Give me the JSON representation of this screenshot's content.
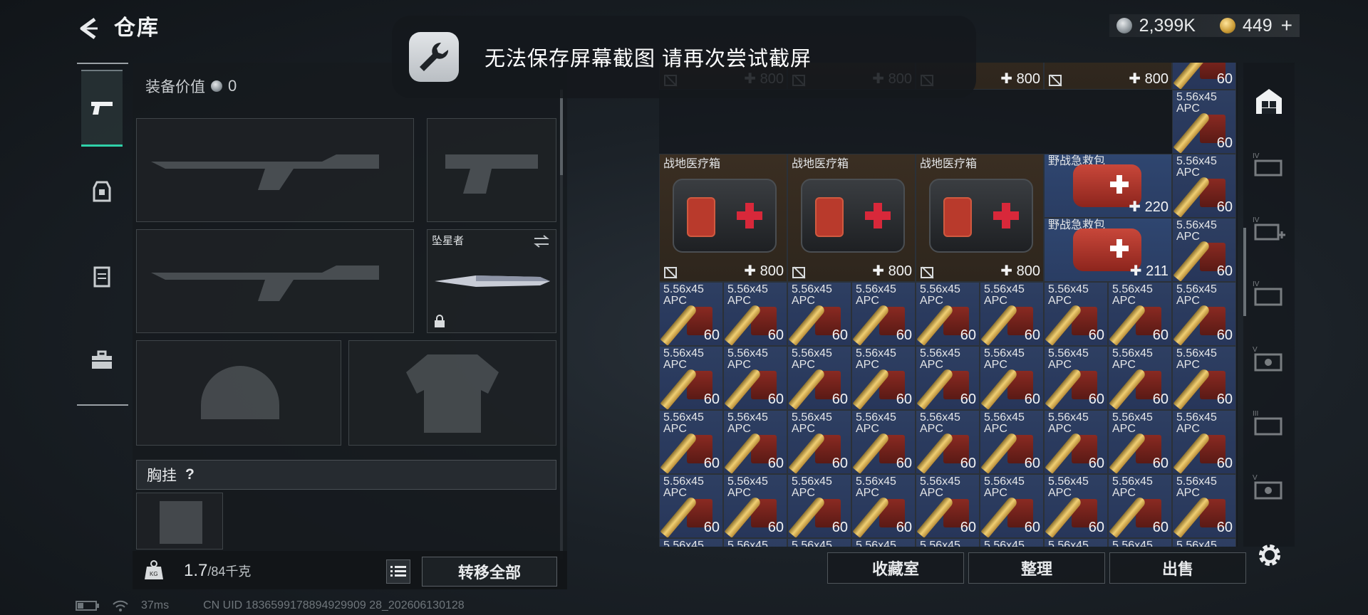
{
  "header": {
    "back_label": "<",
    "title": "仓库"
  },
  "currency": {
    "silver": "2,399K",
    "gold": "449",
    "add_label": "+"
  },
  "toast": {
    "message": "无法保存屏幕截图  请再次尝试截屏"
  },
  "equip": {
    "value_label": "装备价值",
    "value": "0",
    "melee_name": "坠星者",
    "chest_rig_label": "胸挂",
    "chest_rig_help": "?",
    "weight": "1.7",
    "weight_max": "/84千克",
    "transfer_all": "转移全部"
  },
  "storage": {
    "items": {
      "medkit_name": "战地医疗箱",
      "medkit_value": "800",
      "pouch_name": "野战急救包",
      "pouch_value_1": "220",
      "pouch_value_2": "211",
      "ammo_name_1": "5.56x45",
      "ammo_name_2": "APC",
      "ammo_qty": "60"
    },
    "buttons": {
      "vault": "收藏室",
      "sort": "整理",
      "sell": "出售"
    }
  },
  "status": {
    "ping": "37ms",
    "uid": "CN UID 1836599178894929909 28_202606130128"
  },
  "colors": {
    "accent": "#2fd1a9",
    "ammo_bg": "#2e3f62",
    "medkit_bg": "#3a2e22"
  }
}
